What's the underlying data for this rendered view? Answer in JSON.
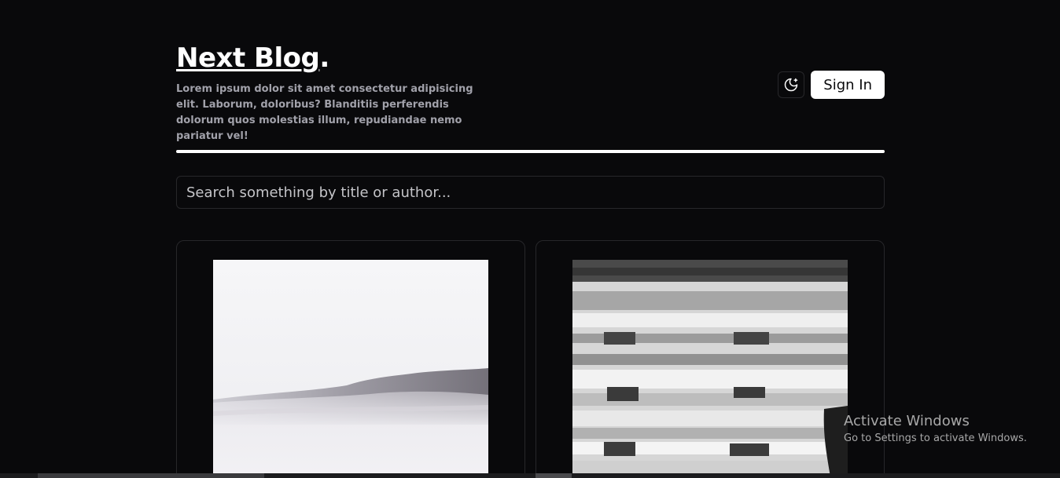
{
  "header": {
    "brand_title_link": "Next Blog",
    "brand_title_dot": ".",
    "tagline": "Lorem ipsum dolor sit amet consectetur adipisicing elit. Laborum, doloribus? Blanditiis perferendis dolorum quos molestias illum, repudiandae nemo pariatur vel!",
    "theme_toggle_icon": "moon-sparkles-icon",
    "sign_in_label": "Sign In"
  },
  "search": {
    "placeholder": "Search something by title or author...",
    "value": ""
  },
  "posts": [
    {
      "image_description": "misty-mountain-landscape"
    },
    {
      "image_description": "black-and-white-building-facade"
    }
  ],
  "watermark": {
    "title": "Activate Windows",
    "subtitle": "Go to Settings to activate Windows."
  },
  "colors": {
    "background": "#09090b",
    "foreground": "#fafafa",
    "muted_text": "#a1a1aa",
    "border": "#27272a",
    "button_bg": "#ffffff",
    "button_text": "#09090b"
  }
}
